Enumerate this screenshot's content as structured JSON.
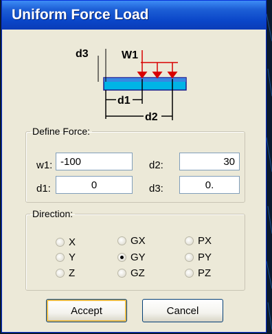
{
  "window": {
    "title": "Uniform Force Load"
  },
  "diagram": {
    "label_d3": "d3",
    "label_w1": "W1",
    "label_d1": "d1",
    "label_d2": "d2",
    "load_color": "#d80000",
    "beam_color": "#00b4e6"
  },
  "define_force": {
    "legend": "Define Force:",
    "w1_label": "w1:",
    "w1_value": "-100",
    "d2_label": "d2:",
    "d2_value": "30",
    "d1_label": "d1:",
    "d1_value": "0",
    "d3_label": "d3:",
    "d3_value": "0."
  },
  "direction": {
    "legend": "Direction:",
    "options": [
      {
        "label": "X",
        "selected": false
      },
      {
        "label": "Y",
        "selected": false
      },
      {
        "label": "Z",
        "selected": false
      },
      {
        "label": "GX",
        "selected": false
      },
      {
        "label": "GY",
        "selected": true
      },
      {
        "label": "GZ",
        "selected": false
      },
      {
        "label": "PX",
        "selected": false
      },
      {
        "label": "PY",
        "selected": false
      },
      {
        "label": "PZ",
        "selected": false
      }
    ]
  },
  "buttons": {
    "accept": "Accept",
    "cancel": "Cancel"
  }
}
